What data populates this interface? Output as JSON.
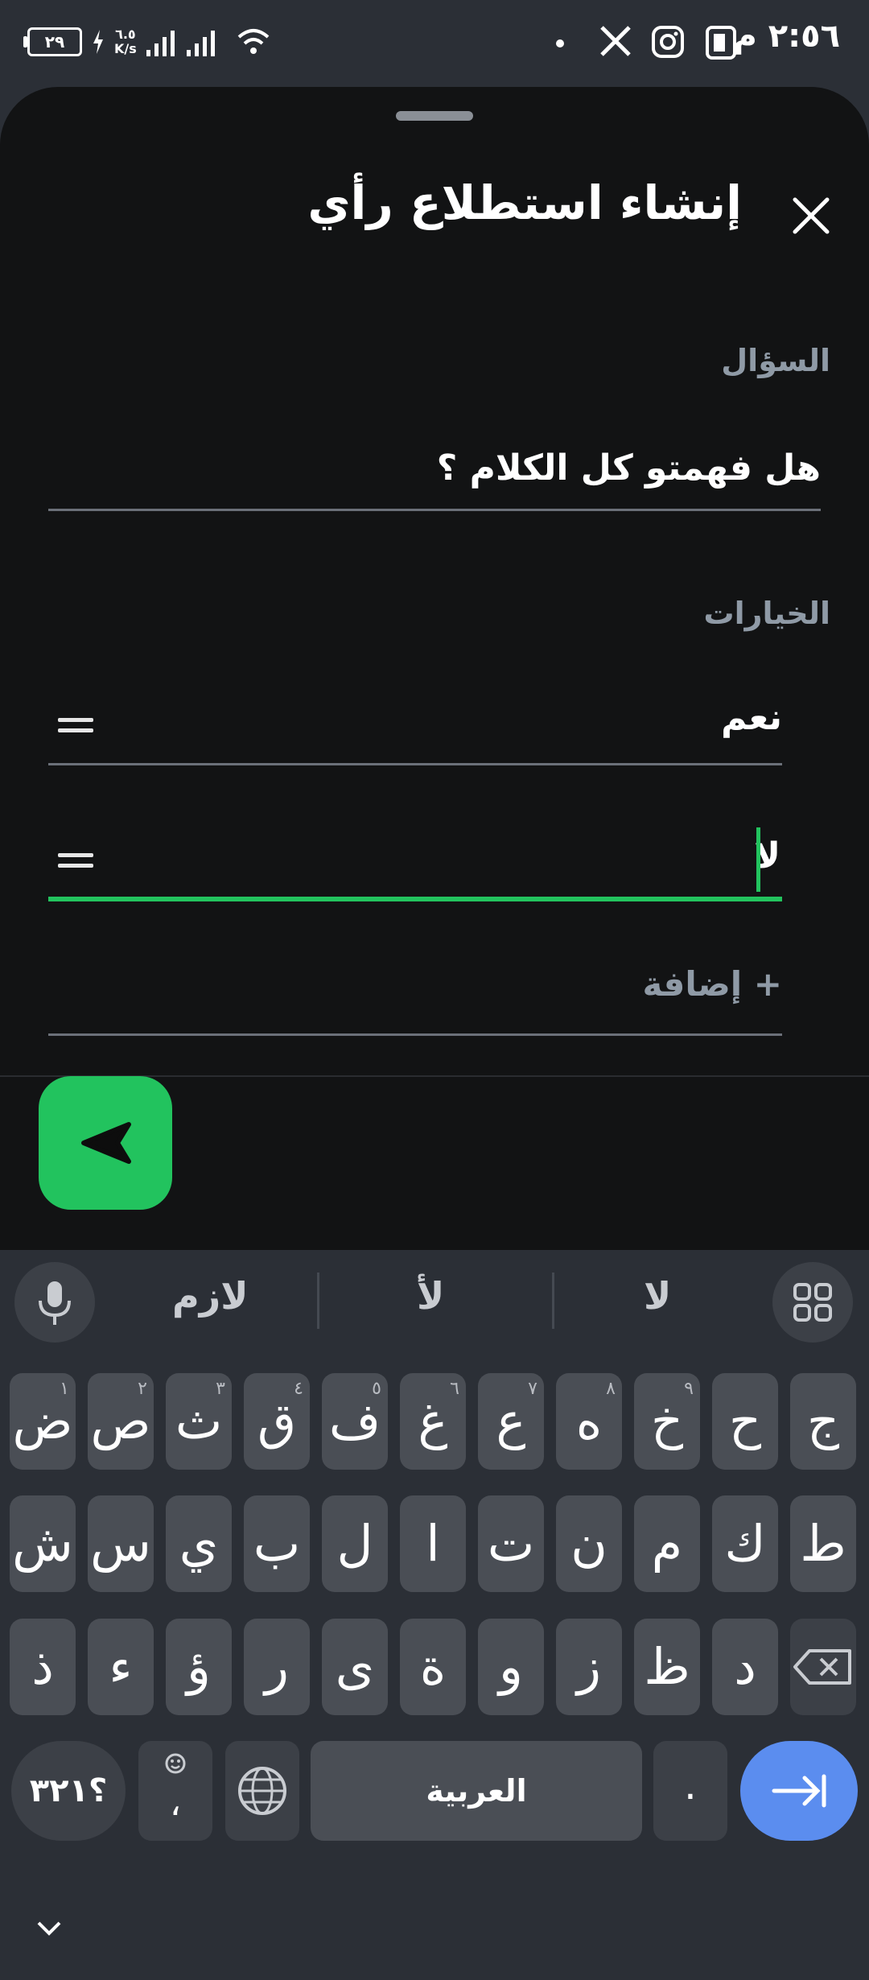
{
  "status_bar": {
    "time": "٢:٥٦ م",
    "battery": "٢٩",
    "net_speed_value": "٦.٥",
    "net_speed_unit": "K/s",
    "app_icons": [
      "x-icon",
      "instagram-icon",
      "news-icon"
    ]
  },
  "sheet": {
    "title": "إنشاء استطلاع رأي",
    "question_label": "السؤال",
    "question_value": "هل فهمتو كل الكلام ؟",
    "options_label": "الخيارات",
    "options": [
      "نعم",
      "لا"
    ],
    "add_option": "+ إضافة",
    "accent_color": "#22c35e"
  },
  "keyboard": {
    "suggestions": [
      "لا",
      "لأ",
      "لازم"
    ],
    "row1": [
      {
        "k": "ج",
        "h": ""
      },
      {
        "k": "ح",
        "h": ""
      },
      {
        "k": "خ",
        "h": "٩"
      },
      {
        "k": "ه",
        "h": "٨"
      },
      {
        "k": "ع",
        "h": "٧"
      },
      {
        "k": "غ",
        "h": "٦"
      },
      {
        "k": "ف",
        "h": "٥"
      },
      {
        "k": "ق",
        "h": "٤"
      },
      {
        "k": "ث",
        "h": "٣"
      },
      {
        "k": "ص",
        "h": "٢"
      },
      {
        "k": "ض",
        "h": "١"
      }
    ],
    "row2": [
      "ط",
      "ك",
      "م",
      "ن",
      "ت",
      "ا",
      "ل",
      "ب",
      "ي",
      "س",
      "ش"
    ],
    "row3": [
      "د",
      "ظ",
      "ز",
      "و",
      "ة",
      "ى",
      "ر",
      "ؤ",
      "ء",
      "ذ"
    ],
    "symbols_key": "؟٣٢١",
    "comma_key": "،",
    "space_label": "العربية",
    "period_key": "."
  }
}
